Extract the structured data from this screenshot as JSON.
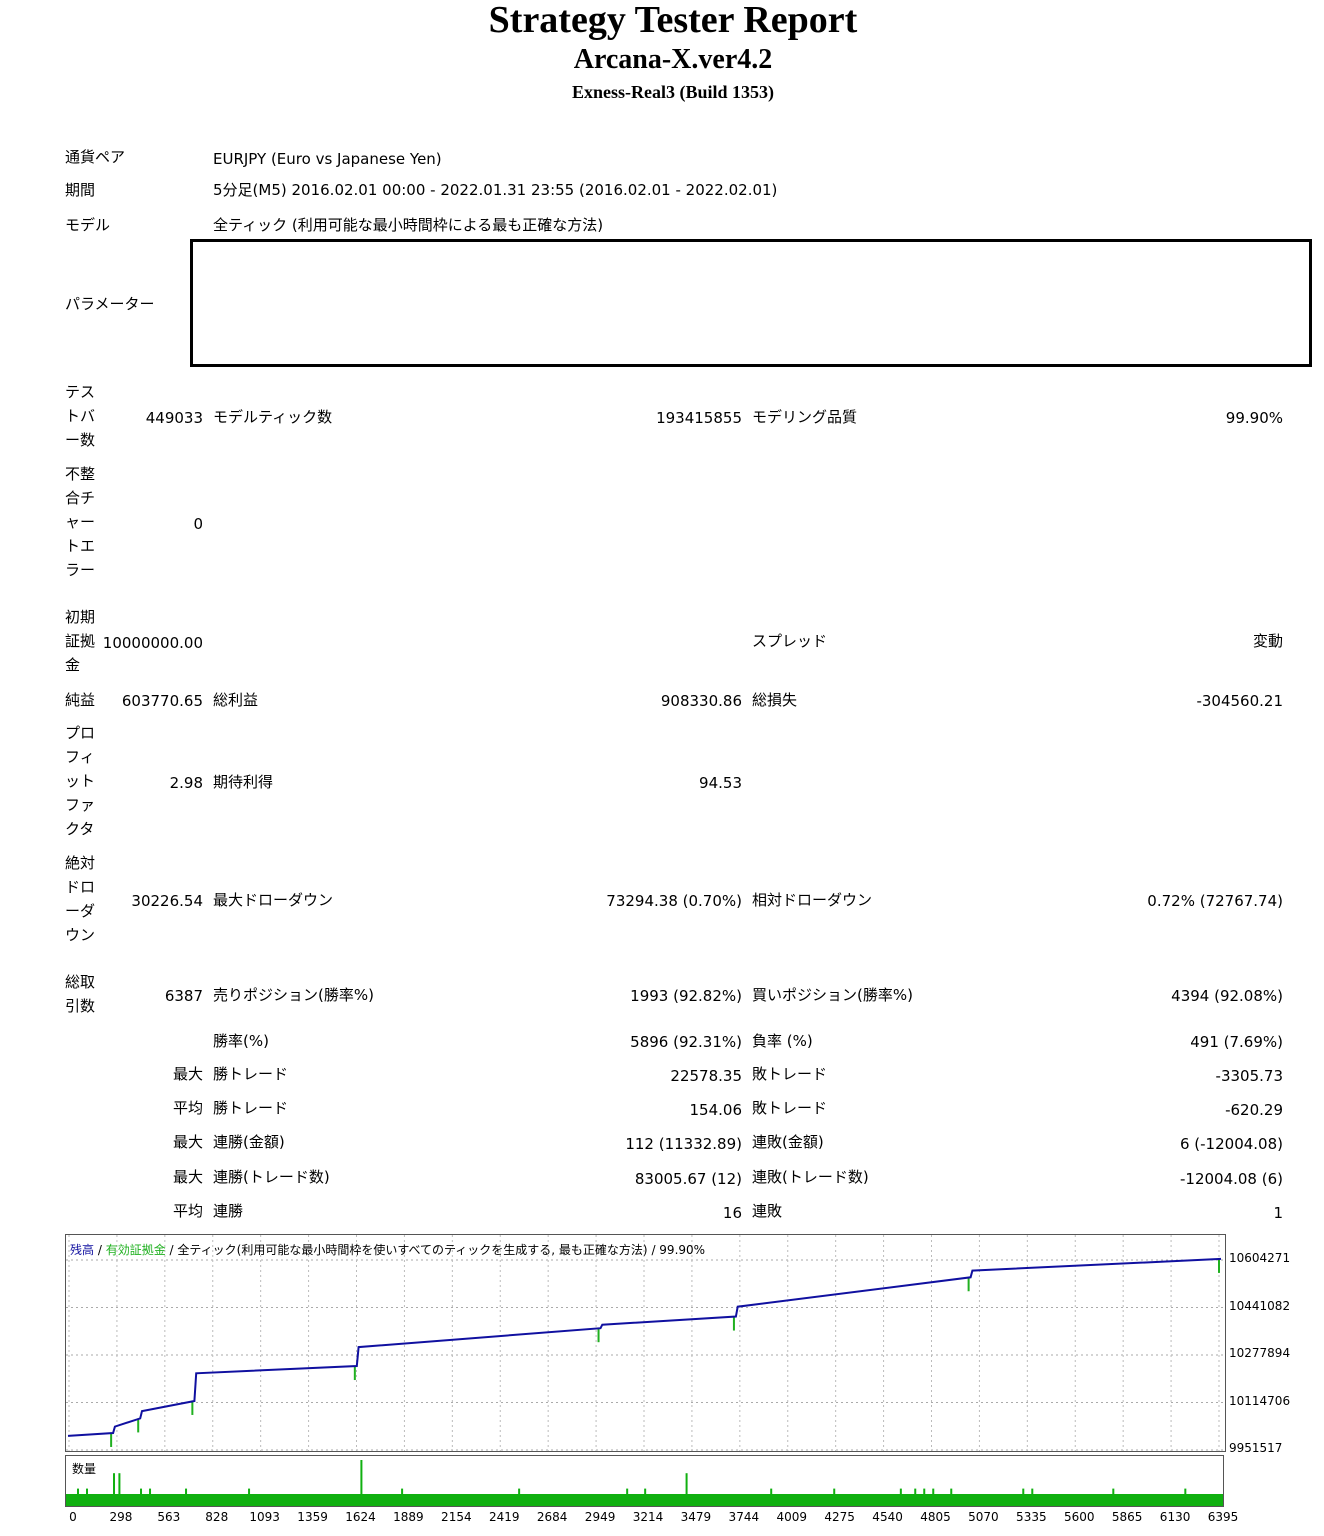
{
  "header": {
    "title": "Strategy Tester Report",
    "ea_name": "Arcana-X.ver4.2",
    "server": "Exness-Real3 (Build 1353)"
  },
  "info": {
    "pair_label": "通貨ペア",
    "pair_value": "EURJPY (Euro vs Japanese Yen)",
    "period_label": "期間",
    "period_value": "5分足(M5) 2016.02.01 00:00 - 2022.01.31 23:55 (2016.02.01 - 2022.02.01)",
    "model_label": "モデル",
    "model_value": "全ティック (利用可能な最小時間枠による最も正確な方法)",
    "params_label": "パラメーター"
  },
  "stats": {
    "bars_label": "テストバー数",
    "bars_value": "449033",
    "ticks_label": "モデルティック数",
    "ticks_value": "193415855",
    "quality_label": "モデリング品質",
    "quality_value": "99.90%",
    "mismatch_label": "不整合チャートエラー",
    "mismatch_value": "0",
    "deposit_label": "初期証拠金",
    "deposit_value": "10000000.00",
    "spread_label": "スプレッド",
    "spread_value": "変動",
    "net_label": "純益",
    "net_value": "603770.65",
    "gross_profit_label": "総利益",
    "gross_profit_value": "908330.86",
    "gross_loss_label": "総損失",
    "gross_loss_value": "-304560.21",
    "pf_label": "プロフィットファクタ",
    "pf_value": "2.98",
    "expected_label": "期待利得",
    "expected_value": "94.53",
    "abs_dd_label": "絶対ドローダウン",
    "abs_dd_value": "30226.54",
    "max_dd_label": "最大ドローダウン",
    "max_dd_value": "73294.38 (0.70%)",
    "rel_dd_label": "相対ドローダウン",
    "rel_dd_value": "0.72% (72767.74)",
    "total_label": "総取引数",
    "total_value": "6387",
    "short_label": "売りポジション(勝率%)",
    "short_value": "1993 (92.82%)",
    "long_label": "買いポジション(勝率%)",
    "long_value": "4394 (92.08%)",
    "win_label": "勝率(%)",
    "win_value": "5896 (92.31%)",
    "loss_label": "負率 (%)",
    "loss_value": "491 (7.69%)",
    "max_label": "最大",
    "avg_label": "平均",
    "max_win_label": "勝トレード",
    "max_win_value": "22578.35",
    "max_loss_label": "敗トレード",
    "max_loss_value": "-3305.73",
    "avg_win_label": "勝トレード",
    "avg_win_value": "154.06",
    "avg_loss_label": "敗トレード",
    "avg_loss_value": "-620.29",
    "cw_money_label": "連勝(金額)",
    "cw_money_value": "112 (11332.89)",
    "cl_money_label": "連敗(金額)",
    "cl_money_value": "6 (-12004.08)",
    "cw_count_label": "連勝(トレード数)",
    "cw_count_value": "83005.67 (12)",
    "cl_count_label": "連敗(トレード数)",
    "cl_count_value": "-12004.08 (6)",
    "avg_cw_label": "連勝",
    "avg_cw_value": "16",
    "avg_cl_label": "連敗",
    "avg_cl_value": "1"
  },
  "chart_legend": {
    "balance": "残高",
    "sep1": " / ",
    "equity": "有効証拠金",
    "sep2": " / ",
    "model": "全ティック(利用可能な最小時間枠を使いすべてのティックを生成する, 最も正確な方法)",
    "sep3": " / ",
    "quality": "99.90%"
  },
  "volume_label": "数量",
  "colors": {
    "balance": "#1010a0",
    "equity": "#20b020",
    "volume": "#10b010"
  },
  "chart_data": {
    "type": "line",
    "ylim": [
      9951517,
      10604271
    ],
    "yticks": [
      "10604271",
      "10441082",
      "10277894",
      "10114706",
      "9951517"
    ],
    "xticks": [
      "0",
      "298",
      "563",
      "828",
      "1093",
      "1359",
      "1624",
      "1889",
      "2154",
      "2419",
      "2684",
      "2949",
      "3214",
      "3479",
      "3744",
      "4009",
      "4275",
      "4540",
      "4805",
      "5070",
      "5335",
      "5600",
      "5865",
      "6130",
      "6395"
    ],
    "xmax": 6387,
    "series": [
      {
        "name": "残高",
        "x": [
          0,
          250,
          260,
          400,
          410,
          700,
          710,
          1600,
          1610,
          2950,
          2960,
          3700,
          3710,
          5000,
          5010,
          6387
        ],
        "values": [
          10000000,
          10010000,
          10032000,
          10060000,
          10085000,
          10120000,
          10215000,
          10240000,
          10305000,
          10370000,
          10382000,
          10410000,
          10444000,
          10545000,
          10568000,
          10608000
        ]
      }
    ],
    "volume": {
      "x": [
        50,
        100,
        250,
        280,
        400,
        450,
        650,
        1000,
        1624,
        1850,
        2500,
        3100,
        3200,
        3430,
        3900,
        4250,
        4620,
        4700,
        4750,
        4800,
        4900,
        5300,
        5350,
        5800,
        6200
      ],
      "values": [
        0.35,
        0.35,
        0.7,
        0.7,
        0.35,
        0.35,
        0.35,
        0.35,
        1.0,
        0.35,
        0.35,
        0.35,
        0.35,
        0.7,
        0.35,
        0.35,
        0.35,
        0.35,
        0.35,
        0.35,
        0.35,
        0.35,
        0.35,
        0.35,
        0.35
      ]
    }
  }
}
